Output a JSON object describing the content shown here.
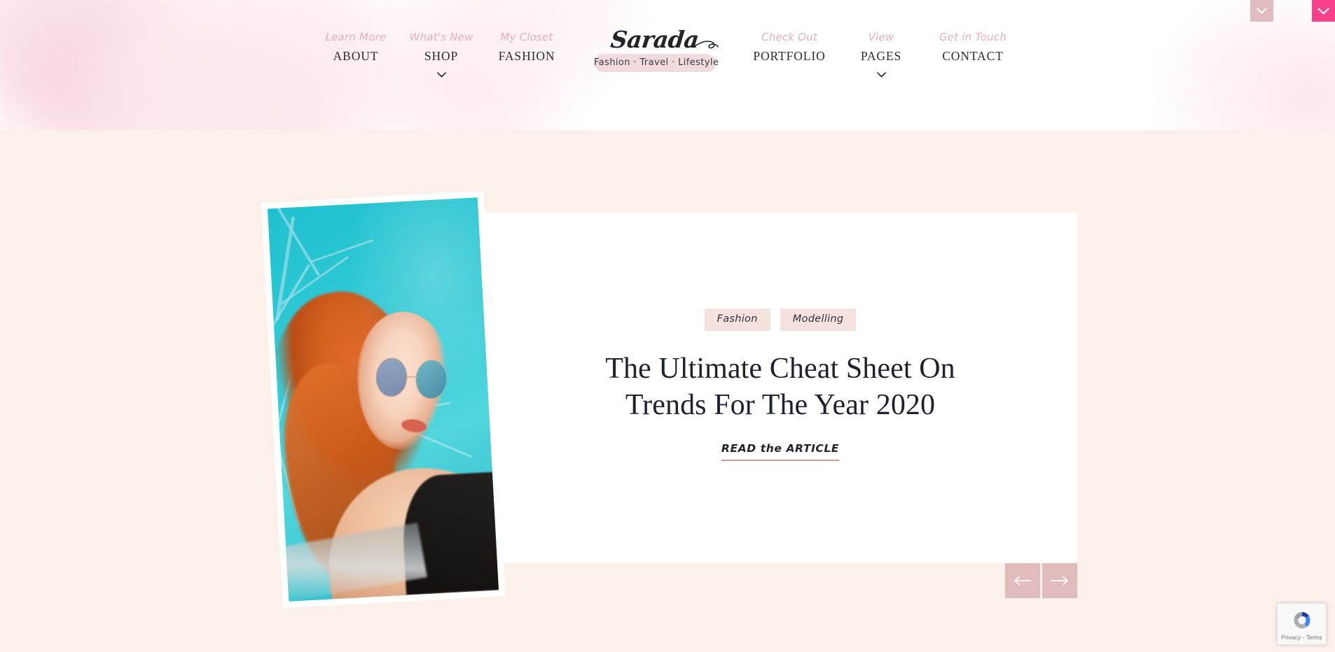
{
  "site": {
    "logo_word": "Sarada",
    "logo_tagline": "Fashion · Travel · Lifestyle"
  },
  "colors": {
    "accent_pink": "#f9408a",
    "muted_pink": "#e0bcc0",
    "hero_bg": "#fcf0ea",
    "pill_bg": "#f5e2df",
    "kicker": "#e8afb4",
    "heading": "#1e2230",
    "underline": "#cb9a9a"
  },
  "nav": {
    "left_items": [
      {
        "kicker": "Learn More",
        "label": "ABOUT",
        "caret": false,
        "icon": ""
      },
      {
        "kicker": "What's New",
        "label": "SHOP",
        "caret": true,
        "icon": "chevron-down-icon"
      },
      {
        "kicker": "My Closet",
        "label": "FASHION",
        "caret": false,
        "icon": ""
      }
    ],
    "right_items": [
      {
        "kicker": "Check Out",
        "label": "PORTFOLIO",
        "caret": false,
        "icon": ""
      },
      {
        "kicker": "View",
        "label": "PAGES",
        "caret": true,
        "icon": "chevron-down-icon"
      },
      {
        "kicker": "Get in Touch",
        "label": "CONTACT",
        "caret": false,
        "icon": ""
      }
    ]
  },
  "topright": {
    "muted_button_icon": "chevron-down-icon",
    "accent_button_icon": "chevron-down-icon"
  },
  "hero": {
    "pills": [
      "Fashion",
      "Modelling"
    ],
    "title": "The Ultimate Cheat Sheet On Trends For The Year 2020",
    "read_link": "READ the ARTICLE",
    "photo_alt": "Red-haired woman in round sunglasses against a teal sky with a ferris wheel",
    "prev_icon": "arrow-left-icon",
    "next_icon": "arrow-right-icon"
  },
  "recaptcha": {
    "text": "Privacy - Terms",
    "icon": "recaptcha-icon"
  }
}
